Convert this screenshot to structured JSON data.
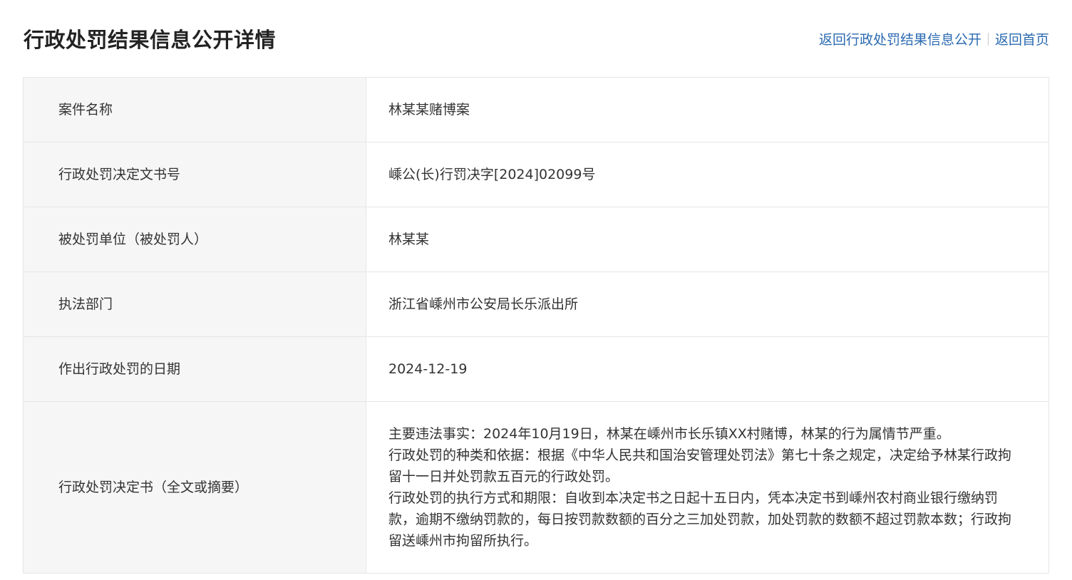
{
  "header": {
    "title": "行政处罚结果信息公开详情",
    "back_list_link": "返回行政处罚结果信息公开",
    "back_home_link": "返回首页"
  },
  "details": {
    "case_name": {
      "label": "案件名称",
      "value": "林某某赌博案"
    },
    "decision_number": {
      "label": "行政处罚决定文书号",
      "value": "嵊公(长)行罚决字[2024]02099号"
    },
    "punished_party": {
      "label": "被处罚单位（被处罚人）",
      "value": "林某某"
    },
    "enforcement_dept": {
      "label": "执法部门",
      "value": "浙江省嵊州市公安局长乐派出所"
    },
    "decision_date": {
      "label": "作出行政处罚的日期",
      "value": "2024-12-19"
    },
    "decision_document": {
      "label": "行政处罚决定书（全文或摘要）",
      "paragraphs": [
        "主要违法事实：2024年10月19日，林某在嵊州市长乐镇XX村赌博，林某的行为属情节严重。",
        "行政处罚的种类和依据：根据《中华人民共和国治安管理处罚法》第七十条之规定，决定给予林某行政拘留十一日并处罚款五百元的行政处罚。",
        "行政处罚的执行方式和期限：自收到本决定书之日起十五日内，凭本决定书到嵊州农村商业银行缴纳罚款，逾期不缴纳罚款的，每日按罚款数额的百分之三加处罚款，加处罚款的数额不超过罚款本数；行政拘留送嵊州市拘留所执行。"
      ]
    }
  },
  "colors": {
    "link": "#2b6ab1",
    "label_bg": "#f6f6f6",
    "border": "#e6e6e6",
    "text": "#333333"
  }
}
